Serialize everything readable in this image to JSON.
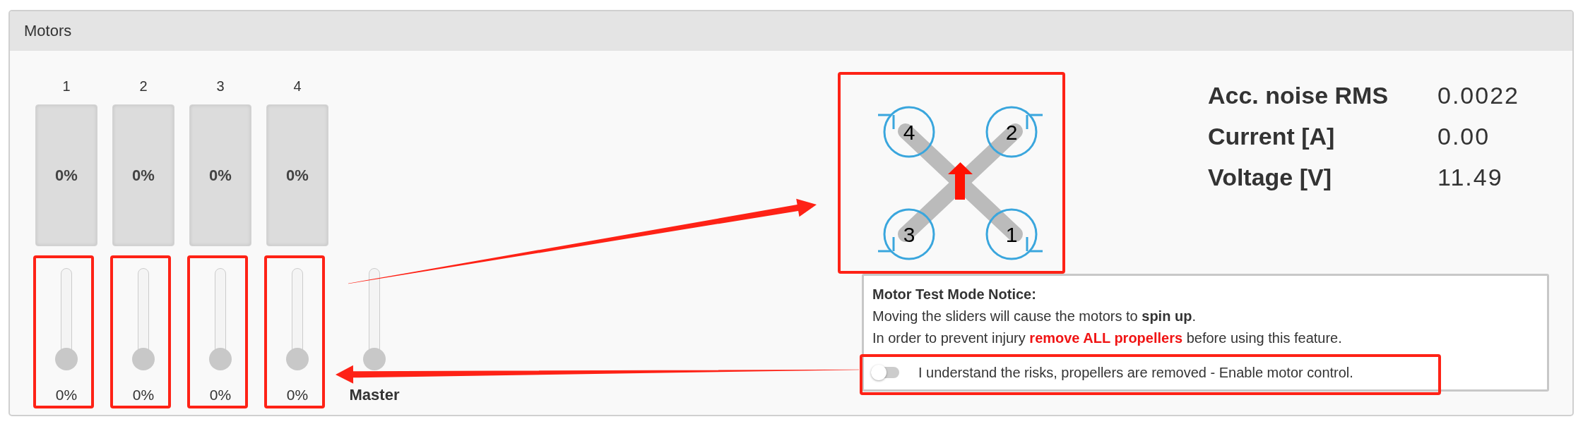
{
  "panel": {
    "title": "Motors"
  },
  "motors": [
    {
      "label": "1",
      "meter": {
        "reading": "0%"
      },
      "slider": {
        "level": 0,
        "reading": "0%",
        "highlighted": true
      }
    },
    {
      "label": "2",
      "meter": {
        "reading": "0%"
      },
      "slider": {
        "level": 0,
        "reading": "0%",
        "highlighted": true
      }
    },
    {
      "label": "3",
      "meter": {
        "reading": "0%"
      },
      "slider": {
        "level": 0,
        "reading": "0%",
        "highlighted": true
      }
    },
    {
      "label": "4",
      "meter": {
        "reading": "0%"
      },
      "slider": {
        "level": 0,
        "reading": "0%",
        "highlighted": true
      }
    }
  ],
  "master": {
    "label": "Master",
    "level": 0
  },
  "quad_diagram": {
    "motor_numbers": [
      "4",
      "2",
      "3",
      "1"
    ],
    "highlighted": true
  },
  "stats": [
    {
      "label": "Acc. noise RMS",
      "value": "0.0022"
    },
    {
      "label": "Current [A]",
      "value": "0.00"
    },
    {
      "label": "Voltage [V]",
      "value": "11.49"
    }
  ],
  "notice": {
    "title": "Motor Test Mode Notice:",
    "lines": [
      {
        "kind": "info",
        "text": "Moving the sliders will cause the motors to **spin up**."
      },
      {
        "kind": "warning",
        "text": "In order to prevent injury **remove ALL propellers** before using this feature."
      }
    ],
    "toggle": {
      "on": false,
      "label": "I understand the risks, propellers are removed - Enable motor control.",
      "highlighted": true
    }
  }
}
